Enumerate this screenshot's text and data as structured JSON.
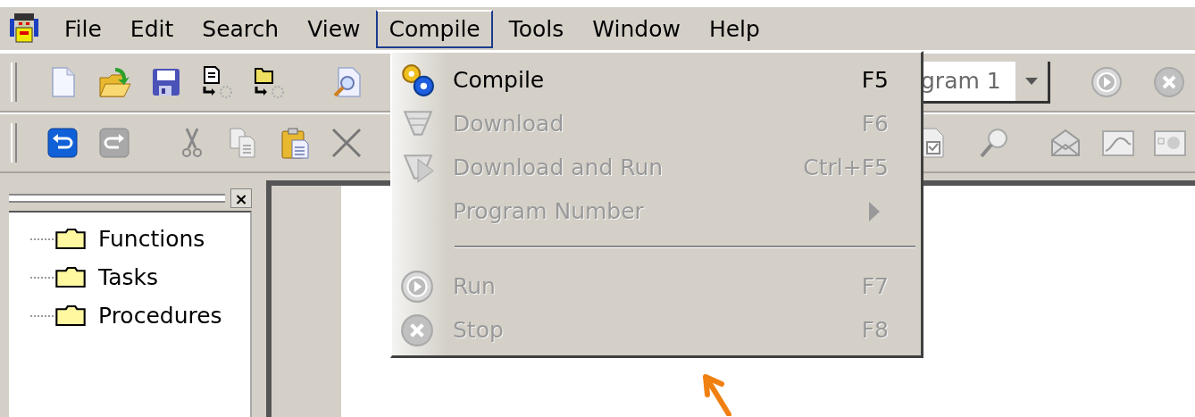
{
  "menubar": {
    "menus": [
      {
        "label": "File",
        "selected": false
      },
      {
        "label": "Edit",
        "selected": false
      },
      {
        "label": "Search",
        "selected": false
      },
      {
        "label": "View",
        "selected": false
      },
      {
        "label": "Compile",
        "selected": true
      },
      {
        "label": "Tools",
        "selected": false
      },
      {
        "label": "Window",
        "selected": false
      },
      {
        "label": "Help",
        "selected": false
      }
    ]
  },
  "toolbar": {
    "program_combo": {
      "value": "gram 1"
    }
  },
  "project_tree": {
    "close_button": "×",
    "items": [
      {
        "label": "Functions"
      },
      {
        "label": "Tasks"
      },
      {
        "label": "Procedures"
      }
    ]
  },
  "compile_menu": {
    "items": [
      {
        "kind": "item",
        "label": "Compile",
        "shortcut": "F5",
        "disabled": false
      },
      {
        "kind": "item",
        "label": "Download",
        "shortcut": "F6",
        "disabled": true
      },
      {
        "kind": "item",
        "label": "Download and Run",
        "shortcut": "Ctrl+F5",
        "disabled": true
      },
      {
        "kind": "submenu",
        "label": "Program Number",
        "disabled": true
      },
      {
        "kind": "separator"
      },
      {
        "kind": "item",
        "label": "Run",
        "shortcut": "F7",
        "disabled": true
      },
      {
        "kind": "item",
        "label": "Stop",
        "shortcut": "F8",
        "disabled": true
      }
    ]
  }
}
